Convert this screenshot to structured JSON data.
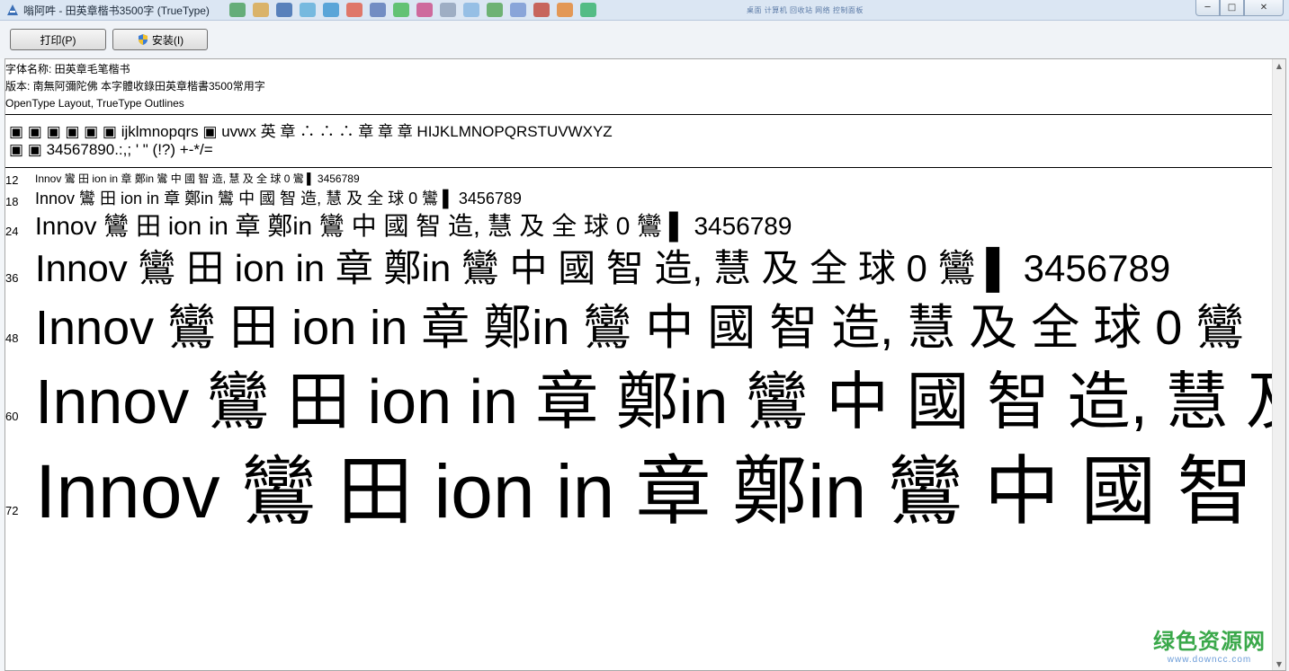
{
  "window": {
    "title": "嗡阿吽 - 田英章楷书3500字 (TrueType)",
    "buttons": {
      "minimize": "─",
      "maximize": "□",
      "close": "✕"
    },
    "strip_text": "桌面 计算机 回收站 网络 控制面板"
  },
  "toolbar": {
    "print_label": "打印(P)",
    "install_label": "安装(I)"
  },
  "font_info": {
    "name_line": "字体名称: 田英章毛笔楷书",
    "version_line": "版本: 南無阿彌陀佛 本字體收錄田英章楷書3500常用字",
    "type_line": "OpenType Layout, TrueType Outlines"
  },
  "charset": {
    "line1": "▣ ▣ ▣ ▣ ▣ ▣ ijklmnopqrs ▣ uvwx 英 章 ∴ ∴ ∴ 章 章 章 HIJKLMNOPQRSTUVWXYZ",
    "line2": "▣ ▣   34567890.:,; ' \" (!?) +-*/="
  },
  "samples": [
    {
      "size": "12",
      "text": "Innov 鸞 田 ion in 章 鄭in 鸞  中 國 智 造,  慧 及 全 球 0 鸞 ▌ 3456789"
    },
    {
      "size": "18",
      "text": "Innov 鸞 田 ion in 章 鄭in 鸞  中 國 智 造,  慧 及 全 球 0 鸞 ▌ 3456789"
    },
    {
      "size": "24",
      "text": "Innov 鸞 田 ion in 章 鄭in 鸞  中 國 智 造,  慧 及 全 球 0 鸞 ▌ 3456789"
    },
    {
      "size": "36",
      "text": "Innov 鸞 田 ion in 章 鄭in 鸞  中 國 智 造,  慧 及 全 球 0 鸞 ▌ 3456789"
    },
    {
      "size": "48",
      "text": "Innov 鸞 田 ion in 章 鄭in 鸞  中 國 智 造,  慧 及 全 球 0 鸞"
    },
    {
      "size": "60",
      "text": "Innov 鸞 田 ion in 章 鄭in 鸞  中 國 智 造,  慧 及"
    },
    {
      "size": "72",
      "text": "Innov 鸞 田 ion in 章 鄭in 鸞  中 國 智 造"
    }
  ],
  "watermark": {
    "main": "绿色资源网",
    "sub": "www.downcc.com"
  },
  "colors": {
    "titlebar": "#dbe6f3",
    "watermark_green": "#3aa84a",
    "watermark_blue": "#6a9bd8"
  }
}
